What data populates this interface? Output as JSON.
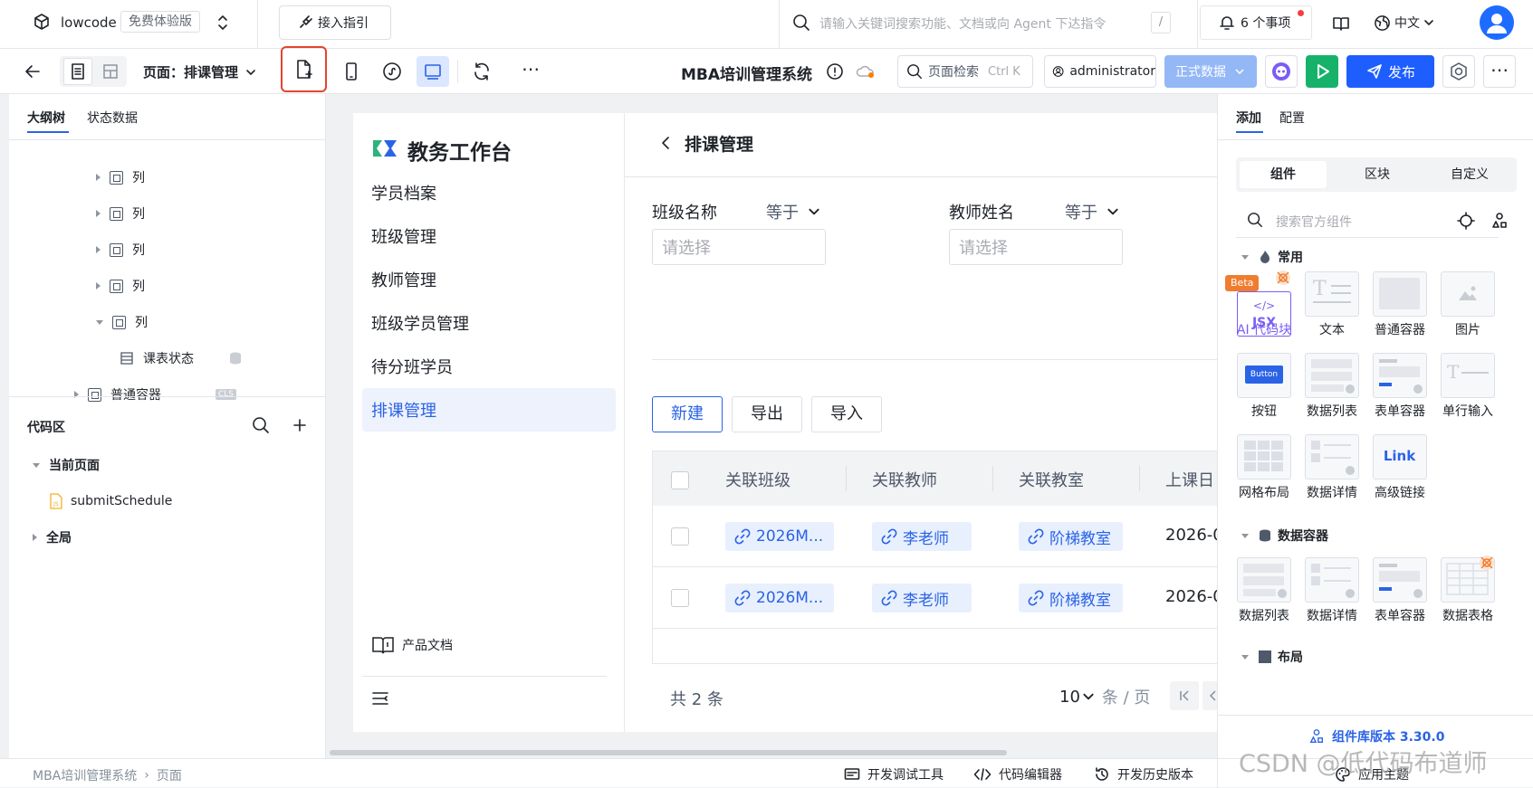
{
  "topbar": {
    "app_name": "lowcode",
    "trial_badge": "免费体验版",
    "guide_button": "接入指引",
    "search_placeholder": "请输入关键词搜索功能、文档或向 Agent 下达指令",
    "search_shortcut": "/",
    "todo_label": "6 个事项",
    "language": "中文"
  },
  "toolbar": {
    "page_label": "页面：排课管理",
    "app_title": "MBA培训管理系统",
    "page_search_label": "页面检索",
    "page_search_shortcut": "Ctrl K",
    "user": "administrator",
    "env_button": "正式数据",
    "publish_button": "发布"
  },
  "left_panel": {
    "tabs": [
      "大纲树",
      "状态数据"
    ],
    "tree": [
      {
        "label": "列"
      },
      {
        "label": "列"
      },
      {
        "label": "列"
      },
      {
        "label": "列"
      },
      {
        "label": "列"
      },
      {
        "label": "课表状态"
      },
      {
        "label": "普通容器",
        "badge": "CLS"
      }
    ],
    "code_area": {
      "title": "代码区",
      "current_page": "当前页面",
      "function_name": "submitSchedule",
      "global": "全局"
    }
  },
  "canvas": {
    "logo_text": "教务工作台",
    "nav": [
      "学员档案",
      "班级管理",
      "教师管理",
      "班级学员管理",
      "待分班学员",
      "排课管理"
    ],
    "product_docs": "产品文档",
    "page_title": "排课管理",
    "filters": [
      {
        "label": "班级名称",
        "operator": "等于",
        "placeholder": "请选择"
      },
      {
        "label": "教师姓名",
        "operator": "等于",
        "placeholder": "请选择"
      }
    ],
    "actions": [
      "新建",
      "导出",
      "导入"
    ],
    "columns": [
      "关联班级",
      "关联教师",
      "关联教室",
      "上课日"
    ],
    "rows": [
      {
        "class": "2026M...",
        "teacher": "李老师",
        "room": "阶梯教室",
        "date": "2026-0"
      },
      {
        "class": "2026M...",
        "teacher": "李老师",
        "room": "阶梯教室",
        "date": "2026-0"
      }
    ],
    "total_label": "共 2 条",
    "page_size": "10",
    "page_size_unit": "条 / 页"
  },
  "right_panel": {
    "tabs": [
      "添加",
      "配置"
    ],
    "segments": [
      "组件",
      "区块",
      "自定义"
    ],
    "search_placeholder": "搜索官方组件",
    "groups": {
      "common": "常用",
      "data_container": "数据容器",
      "layout": "布局"
    },
    "common_items": [
      "AI 代码块",
      "文本",
      "普通容器",
      "图片",
      "按钮",
      "数据列表",
      "表单容器",
      "单行输入",
      "网格布局",
      "数据详情",
      "高级链接"
    ],
    "data_items": [
      "数据列表",
      "数据详情",
      "表单容器",
      "数据表格"
    ],
    "beta_badge": "Beta",
    "jsx_label": "JSX",
    "button_preview": "Button",
    "link_preview": "Link",
    "version": "组件库版本 3.30.0"
  },
  "statusbar": {
    "breadcrumb": [
      "MBA培训管理系统",
      "页面"
    ],
    "dev_tools": "开发调试工具",
    "code_editor": "代码编辑器",
    "history": "开发历史版本",
    "theme": "应用主题",
    "watermark": "CSDN @低代码布道师"
  },
  "colors": {
    "primary": "#2b63e6",
    "publish": "#1e5eff",
    "run": "#17b26a",
    "highlight_border": "#e2452f",
    "beta": "#f07d2f"
  }
}
